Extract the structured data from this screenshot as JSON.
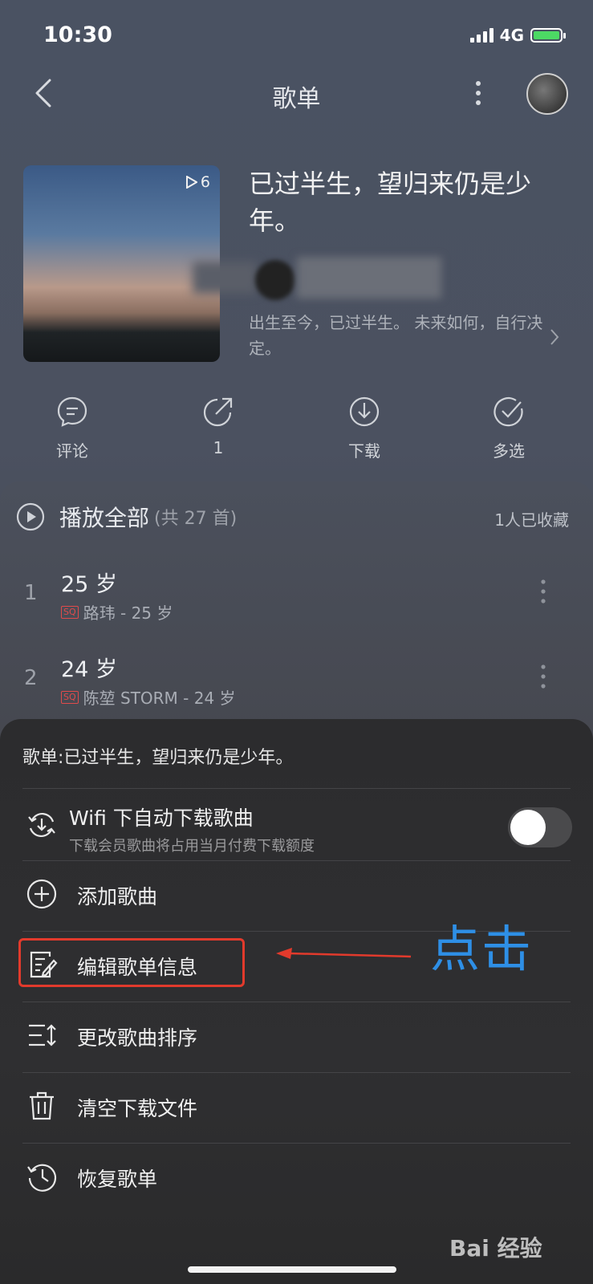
{
  "status": {
    "time": "10:30",
    "network": "4G"
  },
  "nav": {
    "title": "歌单"
  },
  "playlist": {
    "play_count": "6",
    "title": "已过半生，望归来仍是少年。",
    "description": "出生至今，已过半生。 未来如何，自行决定。"
  },
  "actions": [
    {
      "icon": "comment-icon",
      "label": "评论"
    },
    {
      "icon": "share-icon",
      "label": "1"
    },
    {
      "icon": "download-icon",
      "label": "下载"
    },
    {
      "icon": "multiselect-icon",
      "label": "多选"
    }
  ],
  "songs_header": {
    "play_all": "播放全部",
    "count": "(共 27 首)",
    "favorites": "1人已收藏"
  },
  "songs": [
    {
      "index": "1",
      "name": "25 岁",
      "badge": "SQ",
      "meta": "路玮 - 25 岁"
    },
    {
      "index": "2",
      "name": "24 岁",
      "badge": "SQ",
      "meta": "陈堃 STORM - 24 岁"
    }
  ],
  "sheet": {
    "title": "歌单:已过半生，望归来仍是少年。",
    "wifi_label": "Wifi 下自动下载歌曲",
    "wifi_sub": "下载会员歌曲将占用当月付费下载额度",
    "wifi_toggle_on": false,
    "items": [
      {
        "icon": "add-circle-icon",
        "label": "添加歌曲"
      },
      {
        "icon": "edit-info-icon",
        "label": "编辑歌单信息"
      },
      {
        "icon": "sort-icon",
        "label": "更改歌曲排序"
      },
      {
        "icon": "trash-icon",
        "label": "清空下载文件"
      },
      {
        "icon": "history-icon",
        "label": "恢复歌单"
      }
    ]
  },
  "annotation": {
    "text": "点击",
    "color": "#2e8fe6",
    "highlight_color": "#e23a2c"
  },
  "watermark": "Bai 经验"
}
